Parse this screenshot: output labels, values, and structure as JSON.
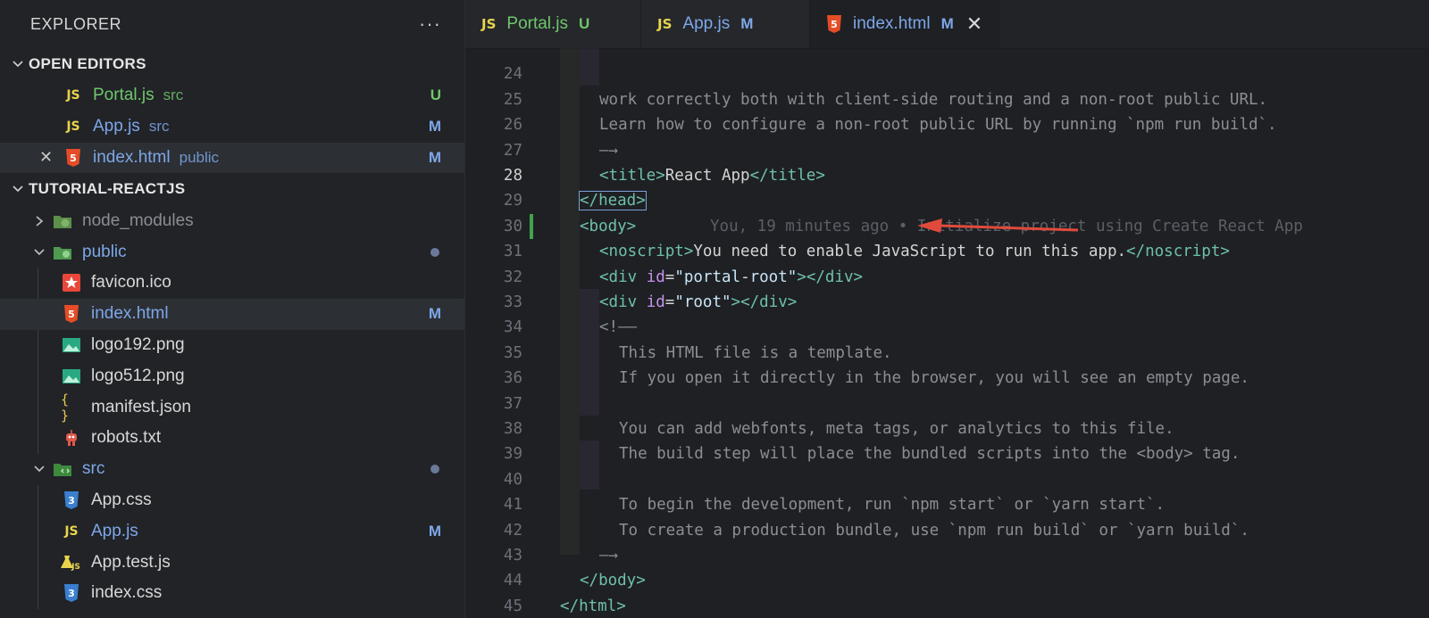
{
  "sidebar": {
    "title": "EXPLORER",
    "more_actions": "···",
    "open_editors": {
      "label": "OPEN EDITORS",
      "items": [
        {
          "icon": "js-icon",
          "icon_text": "JS",
          "name": "Portal.js",
          "folder": "src",
          "badge": "U",
          "color": "#6fc76b"
        },
        {
          "icon": "js-icon",
          "icon_text": "JS",
          "name": "App.js",
          "folder": "src",
          "badge": "M",
          "color": "#7ea7e8"
        },
        {
          "icon": "html5-icon",
          "icon_text": "5",
          "name": "index.html",
          "folder": "public",
          "badge": "M",
          "color": "#7ea7e8"
        }
      ]
    },
    "project": {
      "label": "TUTORIAL-REACTJS",
      "items": [
        {
          "icon": "node-folder-icon",
          "name": "node_modules"
        },
        {
          "icon": "public-folder-icon",
          "name": "public"
        },
        {
          "icon": "favicon-star-icon",
          "name": "favicon.ico"
        },
        {
          "icon": "html5-icon",
          "icon_text": "5",
          "name": "index.html",
          "badge": "M"
        },
        {
          "icon": "image-icon",
          "name": "logo192.png"
        },
        {
          "icon": "image-icon",
          "name": "logo512.png"
        },
        {
          "icon": "json-braces-icon",
          "icon_text": "{ }",
          "name": "manifest.json"
        },
        {
          "icon": "robot-icon",
          "name": "robots.txt"
        },
        {
          "icon": "src-folder-icon",
          "name": "src"
        },
        {
          "icon": "css3-icon",
          "icon_text": "3",
          "name": "App.css"
        },
        {
          "icon": "js-icon",
          "icon_text": "JS",
          "name": "App.js",
          "badge": "M"
        },
        {
          "icon": "test-js-icon",
          "icon_text": "JS",
          "name": "App.test.js"
        },
        {
          "icon": "css3-icon",
          "icon_text": "3",
          "name": "index.css"
        }
      ]
    }
  },
  "tabs": [
    {
      "icon": "js-icon",
      "icon_text": "JS",
      "name": "Portal.js",
      "badge": "U",
      "color": "#6fc76b"
    },
    {
      "icon": "js-icon",
      "icon_text": "JS",
      "name": "App.js",
      "badge": "M",
      "color": "#7ea7e8"
    },
    {
      "icon": "html5-icon",
      "icon_text": "5",
      "name": "index.html",
      "badge": "M",
      "color": "#7ea7e8",
      "close": "✕"
    }
  ],
  "editor": {
    "line_numbers": [
      "24",
      "25",
      "26",
      "27",
      "28",
      "29",
      "30",
      "31",
      "32",
      "33",
      "34",
      "35",
      "36",
      "37",
      "38",
      "39",
      "40",
      "41",
      "42",
      "43",
      "44",
      "45"
    ],
    "current_line": "28",
    "blame": "You, 19 minutes ago • Initialize project using Create React App",
    "lines": {
      "l24": "work correctly both with client-side routing and a non-root public URL.",
      "l25": "Learn how to configure a non-root public URL by running `npm run build`.",
      "l26": "—→",
      "l27_open": "<title>",
      "l27_text": "React App",
      "l27_close": "</title>",
      "l28": "</head>",
      "l29": "<body>",
      "l30_open": "<noscript>",
      "l30_text": "You need to enable JavaScript to run this app.",
      "l30_close": "</noscript>",
      "l31_open": "<div",
      "l31_attr": "id",
      "l31_eq": "=",
      "l31_val": "\"portal-root\"",
      "l31_close": "></div>",
      "l32_open": "<div",
      "l32_attr": "id",
      "l32_eq": "=",
      "l32_val": "\"root\"",
      "l32_close": "></div>",
      "l33": "<!——",
      "l34": "This HTML file is a template.",
      "l35": "If you open it directly in the browser, you will see an empty page.",
      "l37": "You can add webfonts, meta tags, or analytics to this file.",
      "l38": "The build step will place the bundled scripts into the <body> tag.",
      "l40": "To begin the development, run `npm start` or `yarn start`.",
      "l41": "To create a production bundle, use `npm run build` or `yarn build`.",
      "l42": "—→",
      "l43": "</body>",
      "l44": "</html>"
    }
  },
  "annotation": {
    "arrow_color": "#e04a3a",
    "points_to": "portal-root div"
  }
}
